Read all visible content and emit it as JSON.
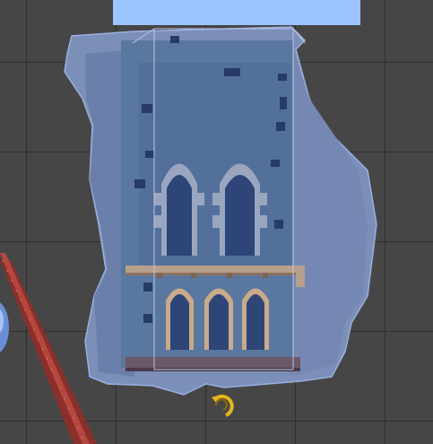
{
  "scene_view": {
    "background_color": "#464646",
    "grid_color": "#2f2f2f",
    "top_band_color": "#9cc5ff",
    "selection_tint_color": "#8fa9e0",
    "objects": {
      "tower": {
        "name": "gothic-tower-model"
      },
      "pipe": {
        "name": "diagonal-red-pipe"
      },
      "sphere": {
        "name": "blue-sphere"
      },
      "gizmo": {
        "name": "rotation-gizmo-icon"
      }
    }
  }
}
